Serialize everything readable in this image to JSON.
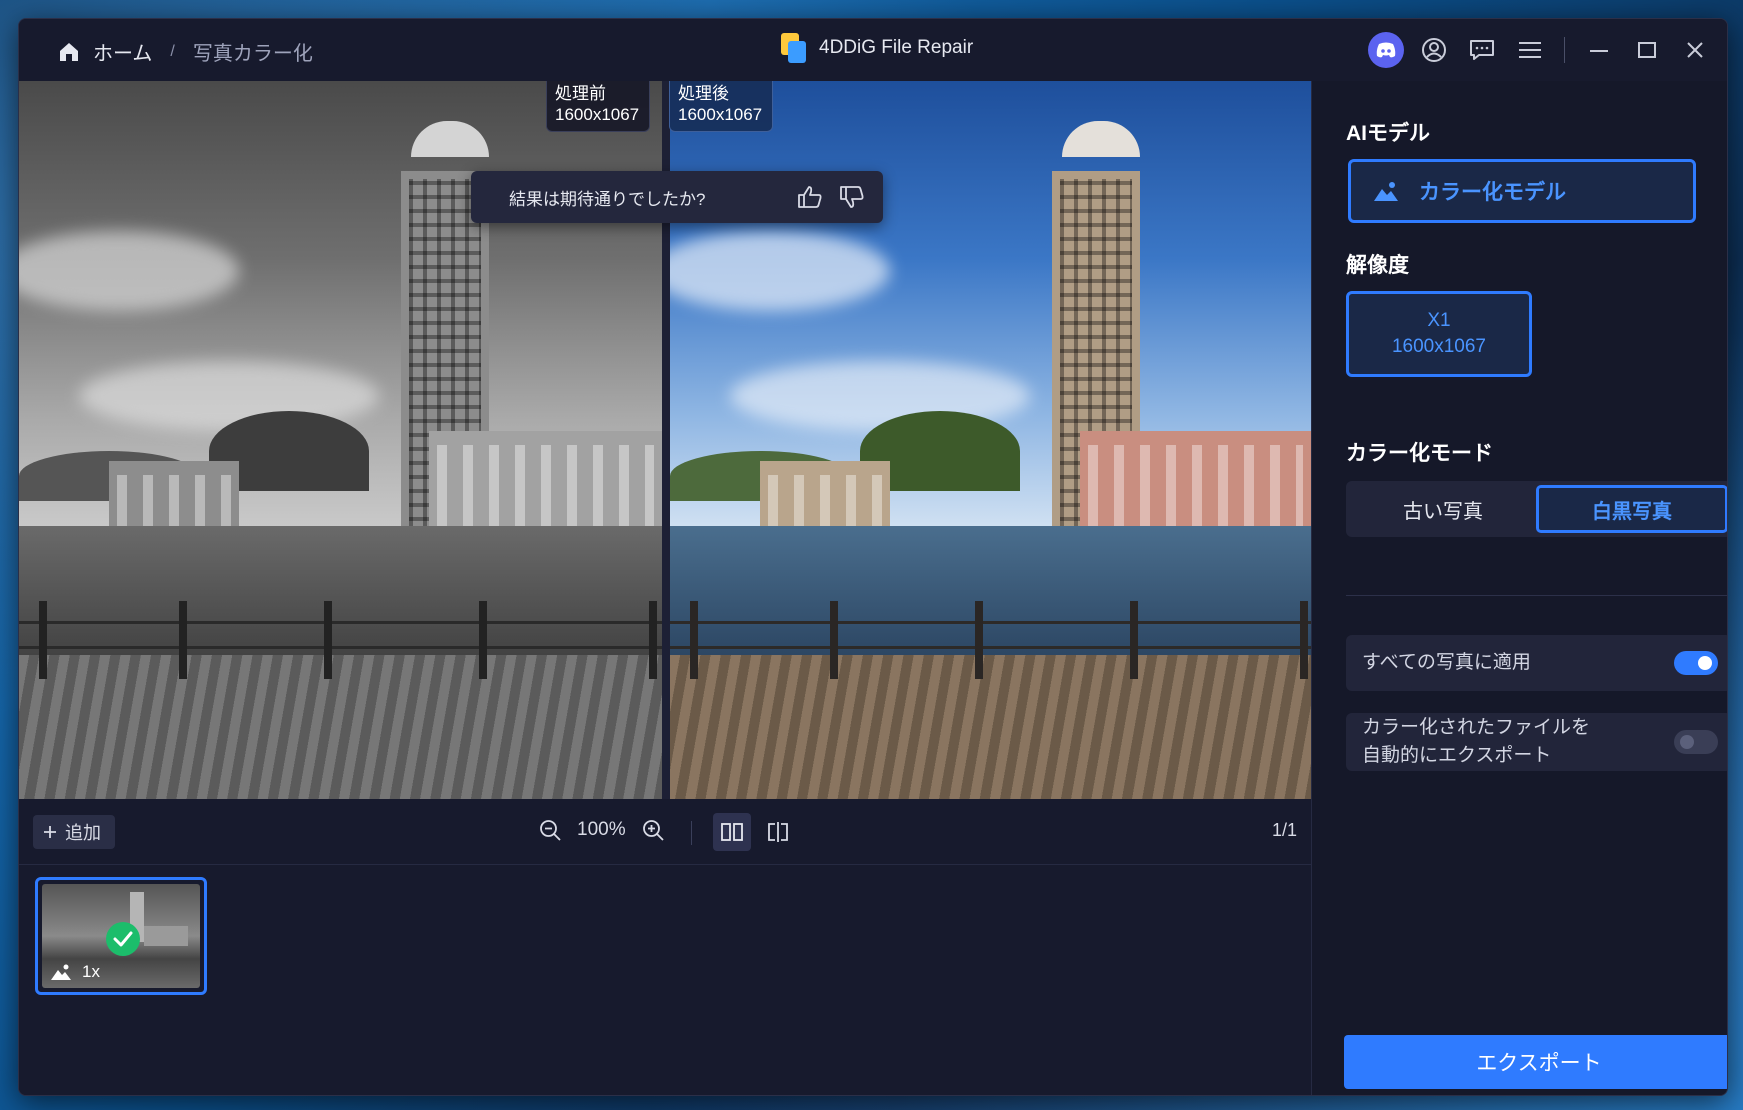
{
  "header": {
    "home_label": "ホーム",
    "separator": "/",
    "current_page": "写真カラー化",
    "app_title": "4DDiG File Repair"
  },
  "preview": {
    "before_tag": {
      "label": "処理前",
      "size": "1600x1067"
    },
    "after_tag": {
      "label": "処理後",
      "size": "1600x1067"
    },
    "feedback_question": "結果は期待通りでしたか?"
  },
  "controls": {
    "add_label": "追加",
    "zoom_level": "100%",
    "page_count": "1/1"
  },
  "thumbnail": {
    "scale_label": "1x",
    "status": "completed"
  },
  "panel": {
    "ai_model_title": "AIモデル",
    "model_name": "カラー化モデル",
    "resolution_title": "解像度",
    "resolution_scale": "X1",
    "resolution_size": "1600x1067",
    "mode_title": "カラー化モード",
    "modes": [
      {
        "label": "古い写真",
        "active": false
      },
      {
        "label": "白黒写真",
        "active": true
      }
    ],
    "options": [
      {
        "label": "すべての写真に適用",
        "enabled": true
      },
      {
        "label": "カラー化されたファイルを\n自動的にエクスポート",
        "enabled": false
      }
    ],
    "export_label": "エクスポート"
  },
  "colors": {
    "accent": "#2f7bff",
    "window_bg": "#171a2d",
    "success": "#1cbd6b"
  }
}
